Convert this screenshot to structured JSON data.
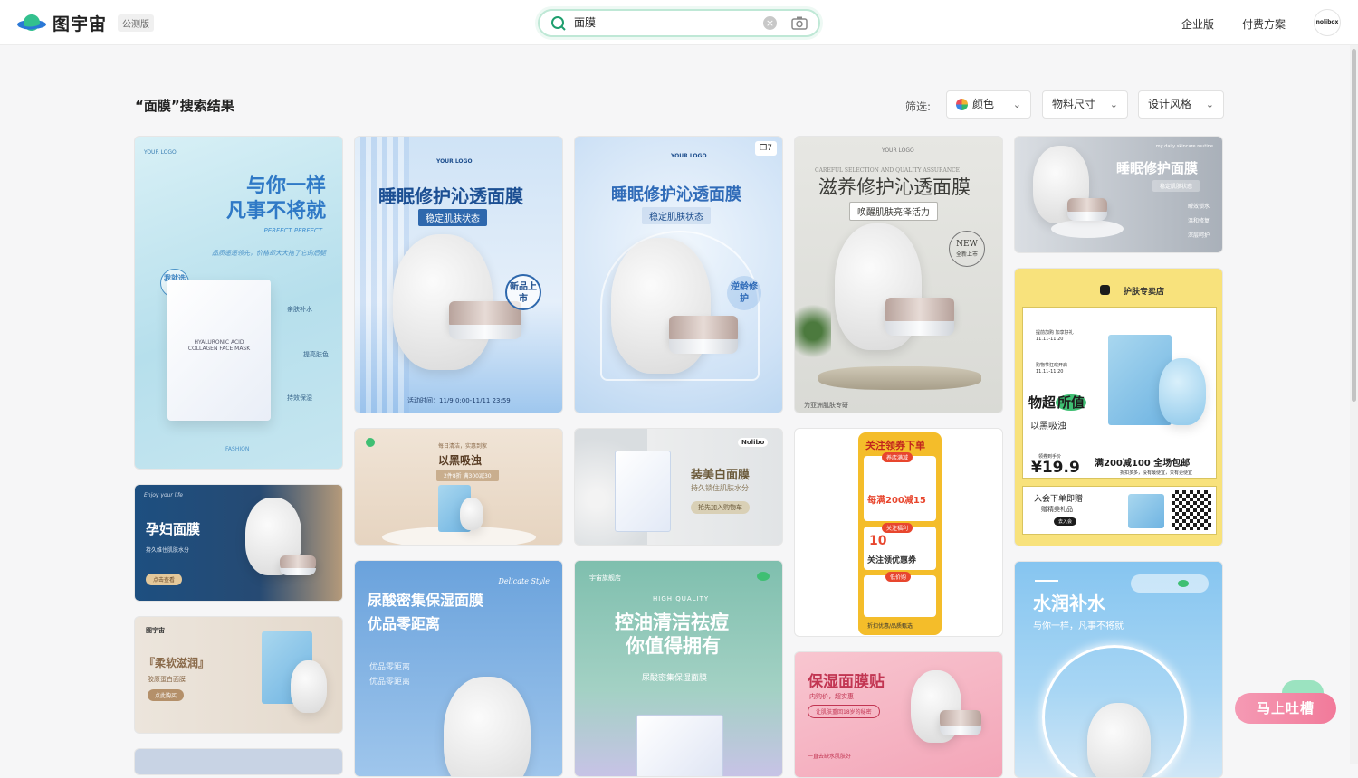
{
  "header": {
    "logo_text": "图宇宙",
    "beta_label": "公测版",
    "search_value": "面膜",
    "nav": [
      "企业版",
      "付费方案"
    ],
    "avatar_text": "nolibox"
  },
  "results": {
    "title": "“面膜”搜索结果",
    "filter_label": "筛选:",
    "filters": [
      "颜色",
      "物料尺寸",
      "设计风格"
    ]
  },
  "cards": {
    "c1": {
      "logo": "YOUR LOGO",
      "title1": "与你一样",
      "title2": "凡事不将就",
      "sub": "PERFECT  PERFECT",
      "desc": "品质遥遥领先，价格却大大拖了它的后腿",
      "seal": "我就选你",
      "f1": "亲肤补水",
      "f2": "提亮肤色",
      "f3": "持效保湿",
      "pack": "HYALURONIC ACID COLLAGEN FACE MASK",
      "footer": "FASHION"
    },
    "c2": {
      "logo": "YOUR LOGO",
      "title": "睡眠修护沁透面膜",
      "sub": "稳定肌肤状态",
      "badge": "新品上市",
      "footer": "活动时间：11/9 0:00-11/11 23:59"
    },
    "c3": {
      "logo": "YOUR LOGO",
      "title": "睡眠修护沁透面膜",
      "sub": "稳定肌肤状态",
      "badge": "逆龄修护",
      "count": "7"
    },
    "c4": {
      "logo": "YOUR LOGO",
      "eng": "CAREFUL SELECTION AND QUALITY ASSURANCE",
      "title": "滋养修护沁透面膜",
      "sub": "唤醒肌肤亮泽活力",
      "badge1": "NEW",
      "badge2": "全新上市",
      "footer": "为亚洲肌肤专研"
    },
    "c5": {
      "eng": "my daily skincare routine",
      "title": "睡眠修护面膜",
      "sub": "稳定肌肤状态",
      "l1": "瞬效锁水",
      "l2": "温和修复",
      "l3": "深层呵护"
    },
    "c6": {
      "title": "孕妇面膜",
      "sub": "持久维住肌肤水分",
      "btn": "点击查看",
      "eng": "Enjoy your life"
    },
    "c7": {
      "title": "以黑吸浊",
      "top": "每日清洁，实惠到家",
      "sub": "2件8折 满300减30"
    },
    "c8": {
      "brand": "Nolibo",
      "title": "装美白面膜",
      "sub": "持久锁住肌肤水分",
      "btn": "抢先加入购物车"
    },
    "c9": {
      "head": "关注领券下单",
      "t1": "养店满减",
      "coupon1": "每满200减15",
      "t2": "关注福利",
      "coupon2": "10",
      "coupon2b": "关注领优惠券",
      "t3": "低价购",
      "footer": "折扣优惠/品质甄选"
    },
    "c10": {
      "shop": "护肤专卖店",
      "slogan1": "物超",
      "slogan2": "所值",
      "slogan3": "以黑吸浊",
      "price_label": "领券到手价",
      "price": "19.9",
      "promo": "满200减100 全场包邮",
      "promo_sub": "折扣多多，没有最便宜，只有更便宜",
      "member": "入会下单即赠",
      "gift": "赠精美礼品",
      "join": "去入会",
      "note1": "提前加购 加享好礼",
      "date1": "11.11-11.20",
      "note2": "购物节狂欢开启",
      "date2": "11.11-11.20"
    },
    "c11": {
      "logo": "图宇宙",
      "title": "『柔软滋润』",
      "sub": "胶原蛋白面膜",
      "btn": "点此购买"
    },
    "c12": {
      "title1": "尿酸密集保湿面膜",
      "title2": "优品零距离",
      "script": "Delicate Style",
      "s1": "优品零距离",
      "s2": "优品零距离"
    },
    "c13": {
      "shop": "宇宙旗舰店",
      "eng": "HIGH QUALITY",
      "title1": "控油清洁祛痘",
      "title2": "你值得拥有",
      "sub": "尿酸密集保湿面膜"
    },
    "c14": {
      "title": "保湿面膜贴",
      "sub": "内购价，超实惠",
      "tag": "让肌肤重回18岁的秘密",
      "foot": "一直去缺水肌肤好"
    },
    "c15": {
      "title": "水润补水",
      "sub": "与你一样，凡事不将就"
    }
  },
  "feedback": {
    "label": "马上吐槽"
  },
  "colors": {
    "accent": "#1f9e6e",
    "brand_blue": "#2f7fe0"
  }
}
